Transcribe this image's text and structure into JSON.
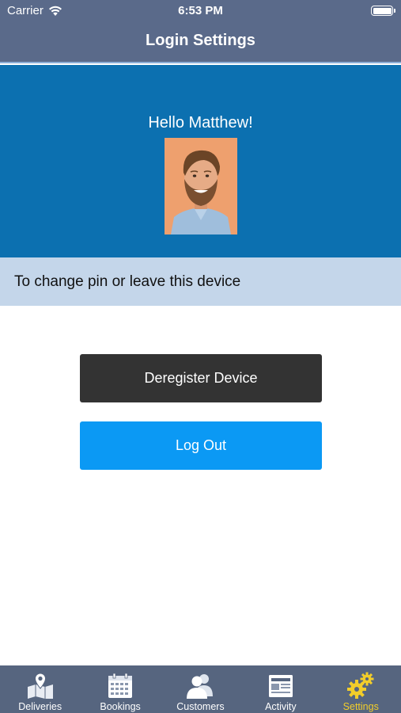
{
  "status_bar": {
    "carrier": "Carrier",
    "time": "6:53 PM"
  },
  "nav": {
    "title": "Login Settings"
  },
  "profile": {
    "greeting": "Hello Matthew!"
  },
  "info": {
    "text": "To change pin or leave this device"
  },
  "buttons": {
    "deregister": "Deregister Device",
    "logout": "Log Out"
  },
  "tabs": [
    {
      "label": "Deliveries",
      "icon": "map-pin-icon"
    },
    {
      "label": "Bookings",
      "icon": "calendar-icon"
    },
    {
      "label": "Customers",
      "icon": "people-icon"
    },
    {
      "label": "Activity",
      "icon": "newspaper-icon"
    },
    {
      "label": "Settings",
      "icon": "gears-icon",
      "active": true
    }
  ],
  "colors": {
    "nav_bg": "#5a6a8a",
    "profile_bg": "#0c70b0",
    "info_bg": "#c4d6ea",
    "deregister_bg": "#333333",
    "logout_bg": "#0b99f4",
    "tab_active": "#f2cd2a"
  }
}
